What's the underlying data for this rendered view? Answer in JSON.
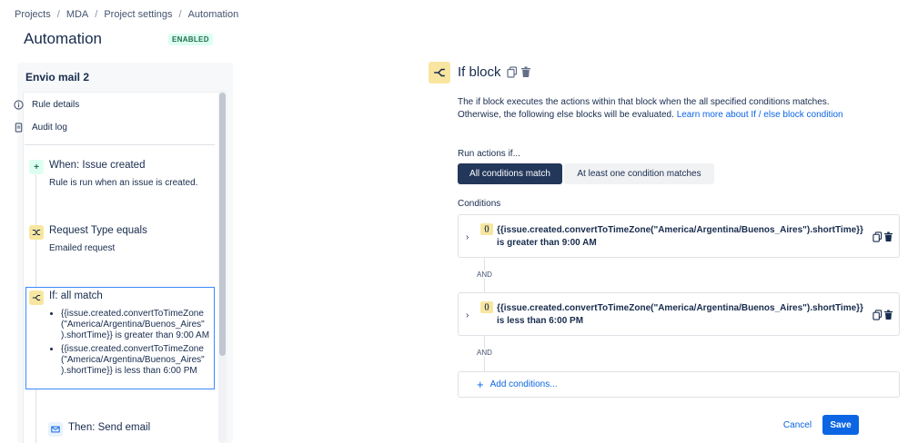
{
  "breadcrumb": [
    "Projects",
    "MDA",
    "Project settings",
    "Automation"
  ],
  "page": {
    "title": "Automation",
    "status": "ENABLED"
  },
  "rule": {
    "name": "Envio mail 2",
    "menu": [
      {
        "label": "Rule details",
        "icon": "info-icon"
      },
      {
        "label": "Audit log",
        "icon": "document-icon"
      }
    ],
    "steps": [
      {
        "title": "When: Issue created",
        "subtitle": "Rule is run when an issue is created.",
        "icon": "plus-icon"
      },
      {
        "title": "Request Type equals",
        "subtitle": "Emailed request",
        "icon": "shuffle-icon"
      },
      {
        "title": "If: all match",
        "icon": "branch-icon",
        "conditions": [
          "{{issue.created.convertToTimeZone (\"America/Argentina/Buenos_Aires\" ).shortTime}} is greater than 9:00 AM",
          "{{issue.created.convertToTimeZone (\"America/Argentina/Buenos_Aires\" ).shortTime}} is less than 6:00 PM"
        ]
      },
      {
        "title": "Then: Send email",
        "icon": "mail-icon"
      }
    ]
  },
  "block": {
    "title": "If block",
    "description": "The if block executes the actions within that block when the all specified conditions matches. Otherwise, the following else blocks will be evaluated.",
    "link_text": "Learn more about If / else block condition",
    "run_label": "Run actions if...",
    "options": [
      "All conditions match",
      "At least one condition matches"
    ],
    "selected_option": "All conditions match",
    "conditions_label": "Conditions",
    "conditions": [
      {
        "expression": "{{issue.created.convertToTimeZone(\"America/Argentina/Buenos_Aires\").shortTime}}",
        "operator": "is greater than 9:00 AM",
        "icon_text": "{}"
      },
      {
        "expression": "{{issue.created.convertToTimeZone(\"America/Argentina/Buenos_Aires\").shortTime}}",
        "operator": "is less than 6:00 PM",
        "icon_text": "{}"
      }
    ],
    "and_label": "AND",
    "add_label": "Add conditions...",
    "cancel_label": "Cancel",
    "save_label": "Save"
  }
}
